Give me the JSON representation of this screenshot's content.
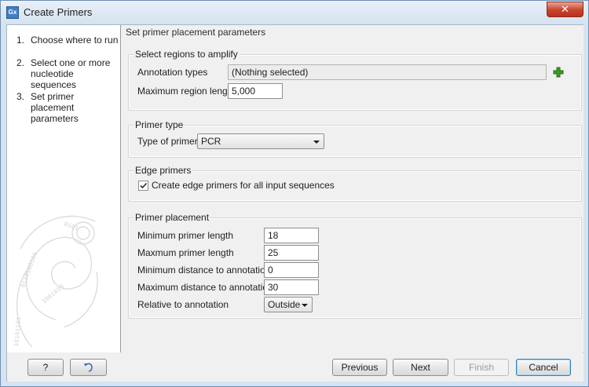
{
  "window": {
    "title": "Create Primers",
    "app_icon_text": "Gx",
    "close_symbol": "✕"
  },
  "steps": [
    {
      "num": "1.",
      "label": "Choose where to run"
    },
    {
      "num": "2.",
      "label": "Select one or more nucleotide sequences"
    },
    {
      "num": "3.",
      "label": "Set primer placement parameters"
    }
  ],
  "main": {
    "header": "Set primer placement parameters",
    "regions": {
      "title": "Select regions to amplify",
      "annotation_types_label": "Annotation types",
      "annotation_types_value": "(Nothing selected)",
      "max_region_label": "Maximum region length",
      "max_region_value": "5,000",
      "add_icon": "plus-icon"
    },
    "primer_type": {
      "title": "Primer type",
      "label": "Type of primer",
      "value": "PCR"
    },
    "edge_primers": {
      "title": "Edge primers",
      "checkbox_label": "Create edge primers for all input sequences",
      "checked": true
    },
    "placement": {
      "title": "Primer placement",
      "min_len_label": "Minimum primer length",
      "min_len_value": "18",
      "max_len_label": "Maxmum primer length",
      "max_len_value": "25",
      "min_dist_label": "Minimum distance to annotation",
      "min_dist_value": "0",
      "max_dist_label": "Maximum distance to annotation",
      "max_dist_value": "30",
      "relative_label": "Relative to annotation",
      "relative_value": "Outside"
    }
  },
  "footer": {
    "help_label": "?",
    "previous_label": "Previous",
    "next_label": "Next",
    "finish_label": "Finish",
    "cancel_label": "Cancel"
  },
  "colors": {
    "accent_green": "#3c9a2a",
    "default_button_border": "#3c7fb1"
  }
}
